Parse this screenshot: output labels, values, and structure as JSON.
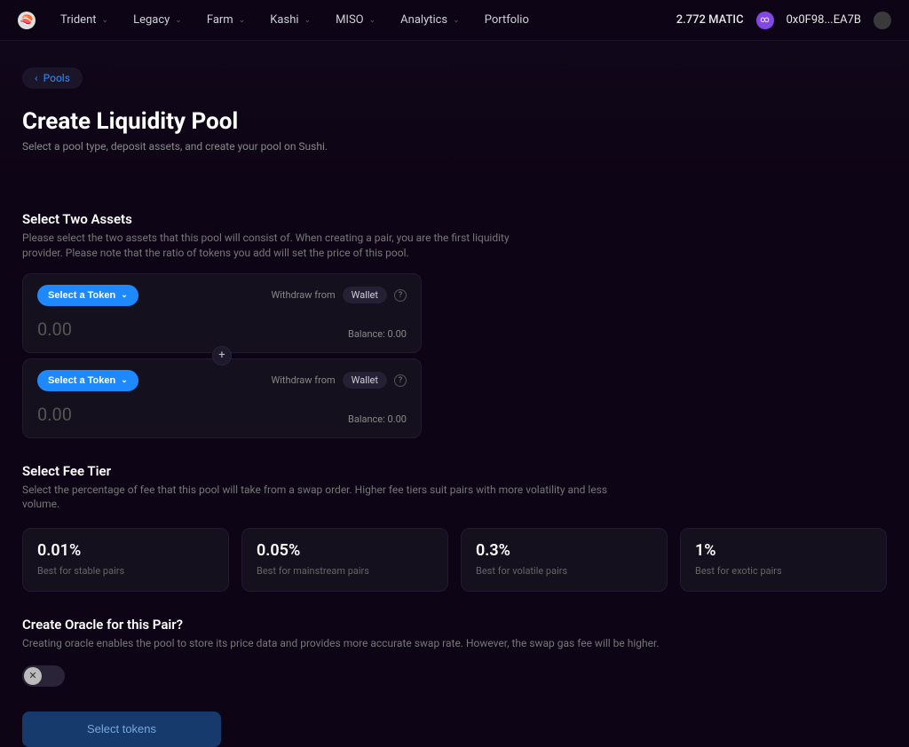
{
  "nav": {
    "items": [
      {
        "label": "Trident",
        "chev": true
      },
      {
        "label": "Legacy",
        "chev": true
      },
      {
        "label": "Farm",
        "chev": true
      },
      {
        "label": "Kashi",
        "chev": true
      },
      {
        "label": "MISO",
        "chev": true
      },
      {
        "label": "Analytics",
        "chev": true
      },
      {
        "label": "Portfolio",
        "chev": false
      }
    ],
    "balance": "2.772 MATIC",
    "address": "0x0F98...EA7B"
  },
  "back_label": "Pools",
  "page": {
    "title": "Create Liquidity Pool",
    "subtitle": "Select a pool type, deposit assets, and create your pool on Sushi."
  },
  "assets_section": {
    "title": "Select Two Assets",
    "desc": "Please select the two assets that this pool will consist of. When creating a pair, you are the first liquidity provider. Please note that the ratio of tokens you add will set the price of this pool.",
    "withdraw_label": "Withdraw from",
    "wallet_label": "Wallet",
    "token_btn": "Select a Token",
    "amount_placeholder": "0.00",
    "balance_prefix": "Balance: ",
    "a": {
      "amount": "0.00",
      "balance": "0.00"
    },
    "b": {
      "amount": "0.00",
      "balance": "0.00"
    }
  },
  "fee_section": {
    "title": "Select Fee Tier",
    "desc": "Select the percentage of fee that this pool will take from a swap order. Higher fee tiers suit pairs with more volatility and less volume.",
    "tiers": [
      {
        "pct": "0.01%",
        "desc": "Best for stable pairs"
      },
      {
        "pct": "0.05%",
        "desc": "Best for mainstream pairs"
      },
      {
        "pct": "0.3%",
        "desc": "Best for volatile pairs"
      },
      {
        "pct": "1%",
        "desc": "Best for exotic pairs"
      }
    ]
  },
  "oracle_section": {
    "title": "Create Oracle for this Pair?",
    "desc": "Creating oracle enables the pool to store its price data and provides more accurate swap rate. However, the swap gas fee will be higher."
  },
  "submit_label": "Select tokens"
}
